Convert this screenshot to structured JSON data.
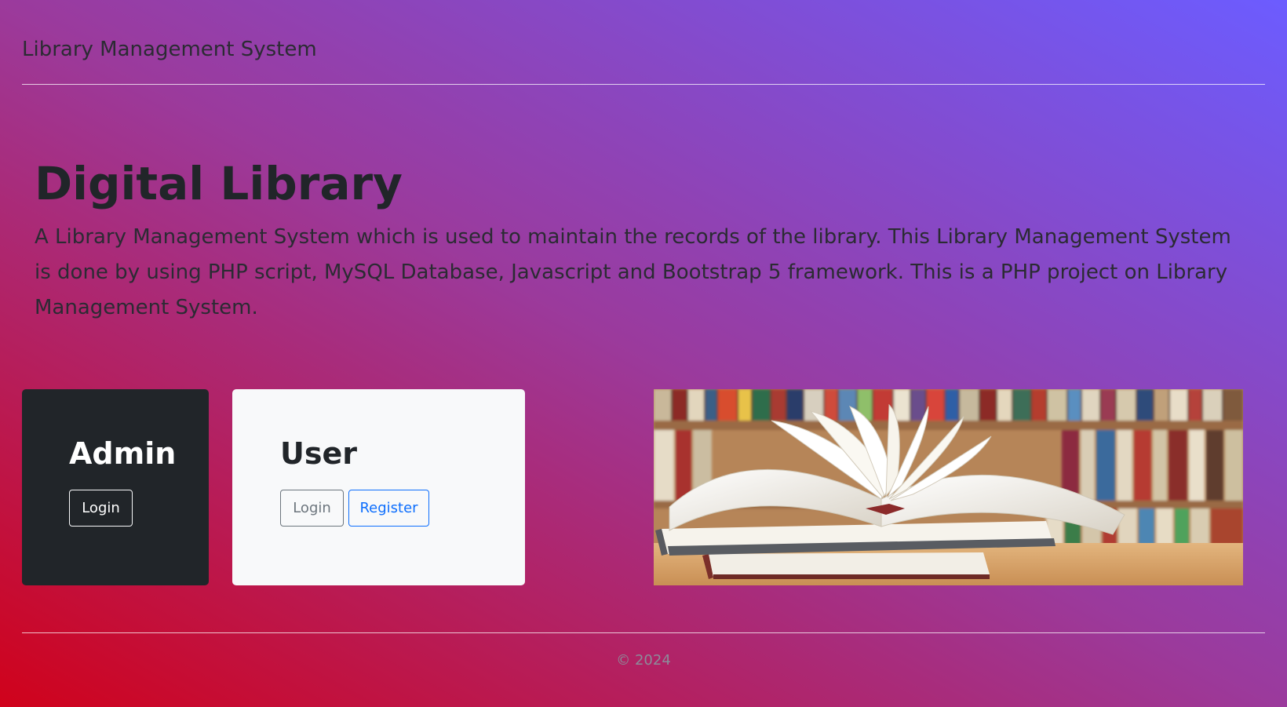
{
  "header": {
    "brand": "Library Management System"
  },
  "hero": {
    "title": "Digital Library",
    "description": "A Library Management System which is used to maintain the records of the library. This Library Management System is done by using PHP script, MySQL Database, Javascript and Bootstrap 5 framework. This is a PHP project on Library Management System."
  },
  "admin_card": {
    "title": "Admin",
    "login_label": "Login"
  },
  "user_card": {
    "title": "User",
    "login_label": "Login",
    "register_label": "Register"
  },
  "image": {
    "subject": "open-book-on-stack-bookshelf-photo"
  },
  "footer": {
    "copyright": "© 2024"
  },
  "colors": {
    "gradient_start": "#d0021b",
    "gradient_mid": "#9b3a9c",
    "gradient_end": "#6c5cff",
    "dark_card": "#212529",
    "light_card": "#f8f9fa",
    "primary": "#0d6efd",
    "secondary": "#6c757d"
  }
}
